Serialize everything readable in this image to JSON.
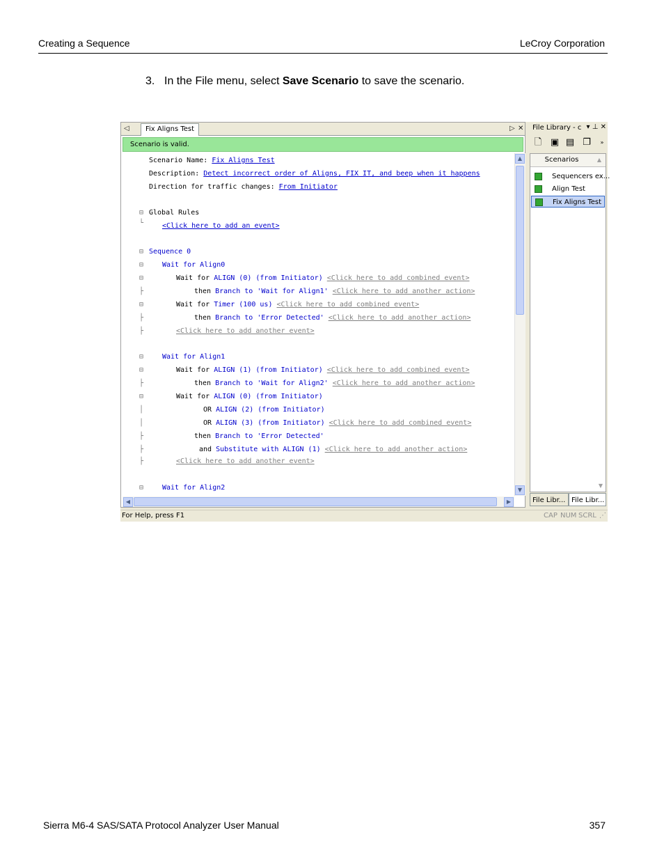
{
  "header": {
    "left": "Creating a Sequence",
    "right": "LeCroy Corporation"
  },
  "step": {
    "number": "3.",
    "text_before": "In the File menu, select ",
    "bold": "Save Scenario",
    "text_after": " to save the scenario."
  },
  "window": {
    "tab_label": "Fix Aligns Test",
    "status_valid": "Scenario is valid.",
    "editor": {
      "l1": {
        "label": "Scenario Name: ",
        "value": "Fix Aligns Test"
      },
      "l2": {
        "label": "Description: ",
        "value": "Detect incorrect order of Aligns, FIX IT, and beep when it happens"
      },
      "l3": {
        "label": "Direction for traffic changes: ",
        "value": "From Initiator"
      },
      "l4": {
        "label": "Global Rules"
      },
      "l5": {
        "value": "<Click here to add an event>"
      },
      "l6": {
        "value": "Sequence 0"
      },
      "l7": {
        "value": "Wait for Align0"
      },
      "l8": {
        "a": "Wait for ",
        "b": "ALIGN (0) (from Initiator)",
        "c": "<Click here to add combined event>"
      },
      "l9": {
        "a": "then ",
        "b": "Branch to 'Wait for Align1'",
        "c": "<Click here to add another action>"
      },
      "l10": {
        "a": "Wait for ",
        "b": "Timer (100 us)",
        "c": "<Click here to add combined event>"
      },
      "l11": {
        "a": "then ",
        "b": "Branch to 'Error Detected'",
        "c": "<Click here to add another action>"
      },
      "l12": {
        "c": "<Click here to add another event>"
      },
      "l13": {
        "value": "Wait for Align1"
      },
      "l14": {
        "a": "Wait for ",
        "b": "ALIGN (1) (from Initiator)",
        "c": "<Click here to add combined event>"
      },
      "l15": {
        "a": "then ",
        "b": "Branch to 'Wait for Align2'",
        "c": "<Click here to add another action>"
      },
      "l16": {
        "a": "Wait for ",
        "b": "ALIGN (0) (from Initiator)"
      },
      "l17": {
        "a": "OR ",
        "b": "ALIGN (2) (from Initiator)"
      },
      "l18": {
        "a": "OR ",
        "b": "ALIGN (3) (from Initiator)",
        "c": "<Click here to add combined event>"
      },
      "l19": {
        "a": "then ",
        "b": "Branch to 'Error Detected'"
      },
      "l20": {
        "a": "and ",
        "b": "Substitute with ALIGN (1)",
        "c": "<Click here to add another action>"
      },
      "l21": {
        "c": "<Click here to add another event>"
      },
      "l22": {
        "value": "Wait for Align2"
      }
    },
    "side": {
      "title": "File Library - c",
      "list_header": "Scenarios",
      "items": [
        "Sequencers ex...",
        "Align Test",
        "Fix Aligns Test"
      ],
      "tabs": [
        "File Libr...",
        "File Libr..."
      ]
    },
    "statusbar": {
      "help": "For Help, press F1",
      "cap": "CAP",
      "num": "NUM",
      "scrl": "SCRL"
    }
  },
  "footer": {
    "left": "Sierra M6-4 SAS/SATA Protocol Analyzer User Manual",
    "right": "357"
  }
}
